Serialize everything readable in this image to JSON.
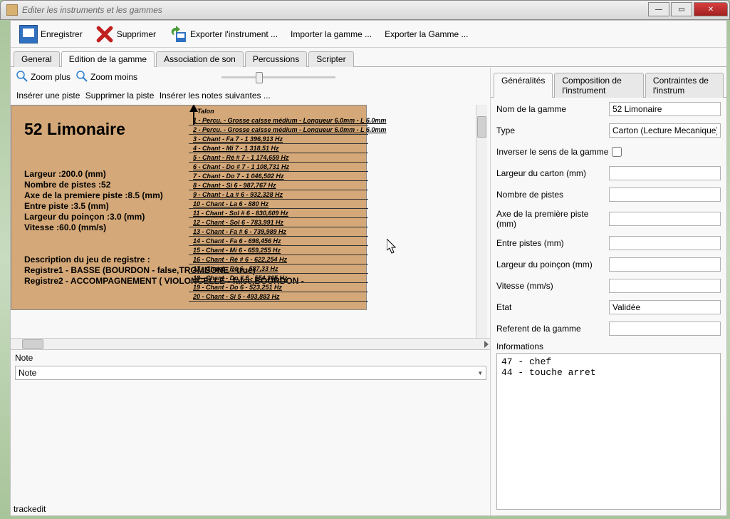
{
  "titlebar": {
    "text": "Editer les instruments et les gammes"
  },
  "toolbar": {
    "save_label": "Enregistrer",
    "delete_label": "Supprimer",
    "export_instrument": "Exporter l'instrument ...",
    "import_gamme": "Importer la gamme ...",
    "export_gamme": "Exporter la Gamme ..."
  },
  "tabs": {
    "general": "General",
    "edition": "Edition de la gamme",
    "association": "Association de son",
    "percussions": "Percussions",
    "scripter": "Scripter"
  },
  "zoom": {
    "plus": "Zoom plus",
    "moins": "Zoom moins"
  },
  "actions": {
    "insert_track": "Insérer une piste",
    "delete_track": "Supprimer la piste",
    "insert_notes": "Insérer les notes suivantes ..."
  },
  "parchment": {
    "talon": "Talon",
    "title": "52 Limonaire",
    "specs": [
      "Largeur :200.0 (mm)",
      "Nombre de pistes :52",
      "Axe de la premiere piste :8.5 (mm)",
      "Entre piste :3.5 (mm)",
      "Largeur du poinçon :3.0 (mm)",
      "Vitesse :60.0 (mm/s)"
    ],
    "desc": [
      "Description du jeu de registre :",
      "Registre1 - BASSE (BOURDON - false,TROMBONE - true)",
      "Registre2 - ACCOMPAGNEMENT ( VIOLONCELLE - false,BOURDON -"
    ],
    "tracks": [
      "1 - Percu. - Grosse caisse médium - Longueur 6.0mm - L 6.0mm",
      "2 - Percu. - Grosse caisse médium - Longueur 6.0mm - L 6.0mm",
      "3 - Chant - Fa 7 - 1 396,913 Hz",
      "4 - Chant - Mi 7 - 1 318,51 Hz",
      "5 - Chant - Ré # 7 - 1 174,659 Hz",
      "6 - Chant - Do # 7 - 1 108,731 Hz",
      "7 - Chant - Do 7 - 1 046,502 Hz",
      "8 - Chant - Si 6 - 987,767 Hz",
      "9 - Chant - La # 6 - 932,328 Hz",
      "10 - Chant - La 6 - 880 Hz",
      "11 - Chant - Sol # 6 - 830,609 Hz",
      "12 - Chant - Sol 6 - 783,991 Hz",
      "13 - Chant - Fa # 6 - 739,989 Hz",
      "14 - Chant - Fa 6 - 698,456 Hz",
      "15 - Chant - Mi 6 - 659,255 Hz",
      "16 - Chant - Ré # 6 - 622,254 Hz",
      "17 - Chant - Ré 6 - 587,33 Hz",
      "18 - Chant - Do # 6 - 554,365 Hz",
      "19 - Chant - Do 6 - 523,251 Hz",
      "20 - Chant - Si 5 - 493,883 Hz"
    ]
  },
  "note_section": {
    "label": "Note",
    "selected": "Note"
  },
  "right_tabs": {
    "generalites": "Généralités",
    "composition": "Composition de l'instrument",
    "contraintes": "Contraintes de l'instrum"
  },
  "form": {
    "labels": {
      "nom": "Nom de la gamme",
      "type": "Type",
      "inverser": "Inverser le sens de la gamme",
      "largeur_carton": "Largeur du carton (mm)",
      "nb_pistes": "Nombre de pistes",
      "axe": "Axe de la première piste (mm)",
      "entre": "Entre pistes (mm)",
      "largeur_poincon": "Largeur du poinçon (mm)",
      "vitesse": "Vitesse (mm/s)",
      "etat": "Etat",
      "referent": "Referent de la gamme",
      "informations": "Informations"
    },
    "values": {
      "nom": "52 Limonaire",
      "type": "Carton (Lecture Mecanique)",
      "inverser": false,
      "largeur_carton": "",
      "nb_pistes": "",
      "axe": "",
      "entre": "",
      "largeur_poincon": "",
      "vitesse": "",
      "etat": "Validée",
      "referent": ""
    }
  },
  "informations_text": "47 - chef\n44 - touche arret",
  "footer": "trackedit"
}
